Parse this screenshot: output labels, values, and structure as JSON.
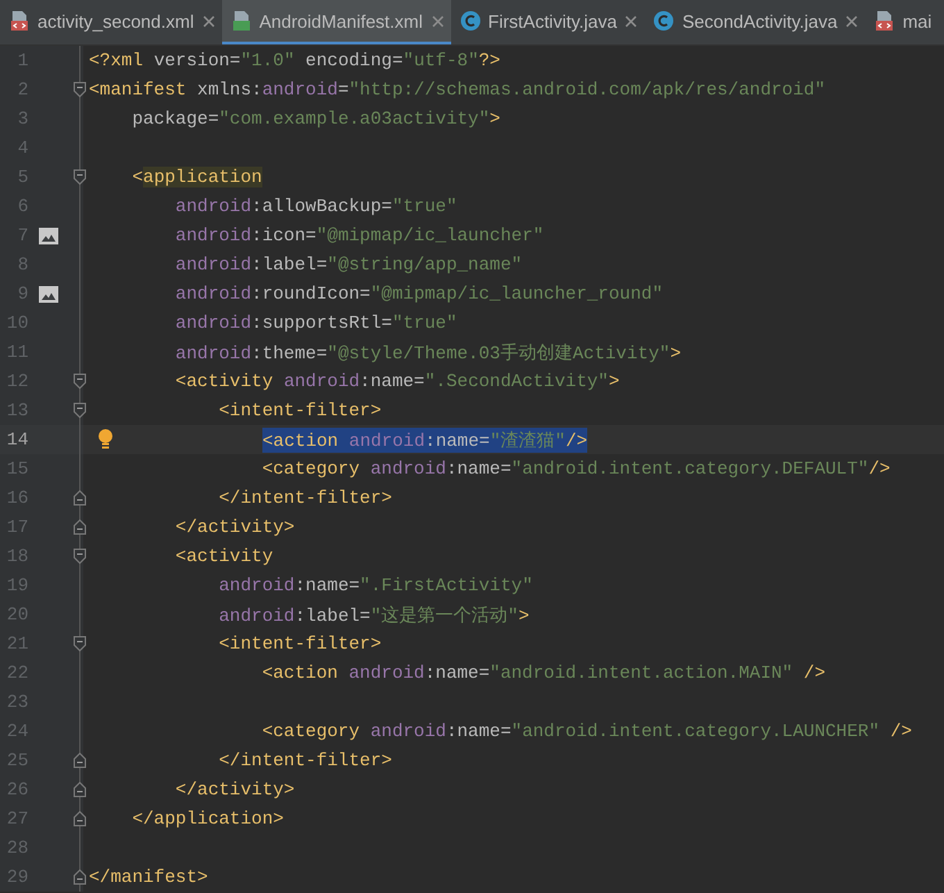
{
  "tabs": [
    {
      "label": "activity_second.xml",
      "kind": "xml",
      "selected": false,
      "closable": true
    },
    {
      "label": "AndroidManifest.xml",
      "kind": "manifest",
      "selected": true,
      "closable": true
    },
    {
      "label": "FirstActivity.java",
      "kind": "class",
      "selected": false,
      "closable": true
    },
    {
      "label": "SecondActivity.java",
      "kind": "class",
      "selected": false,
      "closable": true
    },
    {
      "label": "mai",
      "kind": "xml",
      "selected": false,
      "closable": false
    }
  ],
  "editor": {
    "lines": [
      {
        "number": "1",
        "kind": "plain",
        "fold_start": false,
        "fold_end": false,
        "current": false,
        "selected": false,
        "matched": false,
        "tokens": [
          {
            "kind": "tag",
            "text": "<?xml "
          },
          {
            "kind": "attr",
            "text": "version="
          },
          {
            "kind": "value",
            "text": "\"1.0\""
          },
          {
            "kind": "attr",
            "text": " encoding="
          },
          {
            "kind": "value",
            "text": "\"utf-8\""
          },
          {
            "kind": "tag",
            "text": "?>"
          }
        ]
      },
      {
        "number": "2",
        "kind": "plain",
        "fold_start": true,
        "fold_end": false,
        "current": false,
        "selected": false,
        "matched": false,
        "tokens": [
          {
            "kind": "tag",
            "text": "<manifest "
          },
          {
            "kind": "attr",
            "text": "xmlns:"
          },
          {
            "kind": "ns",
            "text": "android"
          },
          {
            "kind": "attr",
            "text": "="
          },
          {
            "kind": "value",
            "text": "\"http://schemas.android.com/apk/res/android\""
          }
        ]
      },
      {
        "number": "3",
        "kind": "plain",
        "fold_start": false,
        "fold_end": false,
        "current": false,
        "selected": false,
        "matched": false,
        "tokens": [
          {
            "kind": "attr",
            "text": "    package="
          },
          {
            "kind": "value",
            "text": "\"com.example.a03activity\""
          },
          {
            "kind": "tag",
            "text": ">"
          }
        ]
      },
      {
        "number": "4",
        "kind": "plain",
        "fold_start": false,
        "fold_end": false,
        "current": false
      },
      {
        "number": "5",
        "kind": "plain",
        "fold_start": true,
        "fold_end": false,
        "current": false,
        "selected": false,
        "matched": true,
        "tokens": [
          {
            "kind": "tag",
            "text": "    <"
          },
          {
            "kind": "tag",
            "text": "application"
          }
        ]
      },
      {
        "number": "6",
        "kind": "plain",
        "fold_start": false,
        "fold_end": false,
        "current": false,
        "selected": false,
        "matched": false,
        "tokens": [
          {
            "kind": "ns",
            "text": "        android"
          },
          {
            "kind": "attr",
            "text": ":allowBackup="
          },
          {
            "kind": "value",
            "text": "\"true\""
          }
        ]
      },
      {
        "number": "7",
        "kind": "image",
        "fold_start": false,
        "fold_end": false,
        "current": false,
        "selected": false,
        "matched": false,
        "tokens": [
          {
            "kind": "ns",
            "text": "        android"
          },
          {
            "kind": "attr",
            "text": ":icon="
          },
          {
            "kind": "value",
            "text": "\"@mipmap/ic_launcher\""
          }
        ]
      },
      {
        "number": "8",
        "kind": "plain",
        "fold_start": false,
        "fold_end": false,
        "current": false,
        "selected": false,
        "matched": false,
        "tokens": [
          {
            "kind": "ns",
            "text": "        android"
          },
          {
            "kind": "attr",
            "text": ":label="
          },
          {
            "kind": "value",
            "text": "\"@string/app_name\""
          }
        ]
      },
      {
        "number": "9",
        "kind": "image",
        "fold_start": false,
        "fold_end": false,
        "current": false,
        "selected": false,
        "matched": false,
        "tokens": [
          {
            "kind": "ns",
            "text": "        android"
          },
          {
            "kind": "attr",
            "text": ":roundIcon="
          },
          {
            "kind": "value",
            "text": "\"@mipmap/ic_launcher_round\""
          }
        ]
      },
      {
        "number": "10",
        "kind": "plain",
        "fold_start": false,
        "fold_end": false,
        "current": false,
        "selected": false,
        "matched": false,
        "tokens": [
          {
            "kind": "ns",
            "text": "        android"
          },
          {
            "kind": "attr",
            "text": ":supportsRtl="
          },
          {
            "kind": "value",
            "text": "\"true\""
          }
        ]
      },
      {
        "number": "11",
        "kind": "plain",
        "fold_start": false,
        "fold_end": false,
        "current": false,
        "selected": false,
        "matched": false,
        "tokens": [
          {
            "kind": "ns",
            "text": "        android"
          },
          {
            "kind": "attr",
            "text": ":theme="
          },
          {
            "kind": "value",
            "text": "\"@style/Theme.03手动创建Activity\""
          },
          {
            "kind": "tag",
            "text": ">"
          }
        ]
      },
      {
        "number": "12",
        "kind": "plain",
        "fold_start": true,
        "fold_end": false,
        "current": false,
        "selected": false,
        "matched": false,
        "tokens": [
          {
            "kind": "tag",
            "text": "        <activity "
          },
          {
            "kind": "ns",
            "text": "android"
          },
          {
            "kind": "attr",
            "text": ":name="
          },
          {
            "kind": "value",
            "text": "\".SecondActivity\""
          },
          {
            "kind": "tag",
            "text": ">"
          }
        ]
      },
      {
        "number": "13",
        "kind": "plain",
        "fold_start": true,
        "fold_end": false,
        "current": false,
        "selected": false,
        "matched": false,
        "tokens": [
          {
            "kind": "tag",
            "text": "            <intent-filter>"
          }
        ]
      },
      {
        "number": "14",
        "kind": "bulb",
        "fold_start": false,
        "fold_end": false,
        "current": true,
        "selected": true,
        "matched": false,
        "tokens": [
          {
            "kind": "tag",
            "text": "<action "
          },
          {
            "kind": "ns",
            "text": "android"
          },
          {
            "kind": "attr",
            "text": ":name="
          },
          {
            "kind": "value",
            "text": "\"渣渣猫\""
          },
          {
            "kind": "tag",
            "text": "/>"
          }
        ]
      },
      {
        "number": "15",
        "kind": "plain",
        "fold_start": false,
        "fold_end": false,
        "current": false,
        "selected": false,
        "matched": false,
        "tokens": [
          {
            "kind": "tag",
            "text": "                <category "
          },
          {
            "kind": "ns",
            "text": "android"
          },
          {
            "kind": "attr",
            "text": ":name="
          },
          {
            "kind": "value",
            "text": "\"android.intent.category.DEFAULT\""
          },
          {
            "kind": "tag",
            "text": "/>"
          }
        ]
      },
      {
        "number": "16",
        "kind": "plain",
        "fold_start": false,
        "fold_end": true,
        "current": false,
        "selected": false,
        "matched": false,
        "tokens": [
          {
            "kind": "tag",
            "text": "            </intent-filter>"
          }
        ]
      },
      {
        "number": "17",
        "kind": "plain",
        "fold_start": false,
        "fold_end": true,
        "current": false,
        "selected": false,
        "matched": false,
        "tokens": [
          {
            "kind": "tag",
            "text": "        </activity>"
          }
        ]
      },
      {
        "number": "18",
        "kind": "plain",
        "fold_start": true,
        "fold_end": false,
        "current": false,
        "selected": false,
        "matched": false,
        "tokens": [
          {
            "kind": "tag",
            "text": "        <activity"
          }
        ]
      },
      {
        "number": "19",
        "kind": "plain",
        "fold_start": false,
        "fold_end": false,
        "current": false,
        "selected": false,
        "matched": false,
        "tokens": [
          {
            "kind": "ns",
            "text": "            android"
          },
          {
            "kind": "attr",
            "text": ":name="
          },
          {
            "kind": "value",
            "text": "\".FirstActivity\""
          }
        ]
      },
      {
        "number": "20",
        "kind": "plain",
        "fold_start": false,
        "fold_end": false,
        "current": false,
        "selected": false,
        "matched": false,
        "tokens": [
          {
            "kind": "ns",
            "text": "            android"
          },
          {
            "kind": "attr",
            "text": ":label="
          },
          {
            "kind": "value",
            "text": "\"这是第一个活动\""
          },
          {
            "kind": "tag",
            "text": ">"
          }
        ]
      },
      {
        "number": "21",
        "kind": "plain",
        "fold_start": true,
        "fold_end": false,
        "current": false,
        "selected": false,
        "matched": false,
        "tokens": [
          {
            "kind": "tag",
            "text": "            <intent-filter>"
          }
        ]
      },
      {
        "number": "22",
        "kind": "plain",
        "fold_start": false,
        "fold_end": false,
        "current": false,
        "selected": false,
        "matched": false,
        "tokens": [
          {
            "kind": "tag",
            "text": "                <action "
          },
          {
            "kind": "ns",
            "text": "android"
          },
          {
            "kind": "attr",
            "text": ":name="
          },
          {
            "kind": "value",
            "text": "\"android.intent.action.MAIN\""
          },
          {
            "kind": "tag",
            "text": " />"
          }
        ]
      },
      {
        "number": "23",
        "kind": "plain",
        "fold_start": false,
        "fold_end": false,
        "current": false
      },
      {
        "number": "24",
        "kind": "plain",
        "fold_start": false,
        "fold_end": false,
        "current": false,
        "selected": false,
        "matched": false,
        "tokens": [
          {
            "kind": "tag",
            "text": "                <category "
          },
          {
            "kind": "ns",
            "text": "android"
          },
          {
            "kind": "attr",
            "text": ":name="
          },
          {
            "kind": "value",
            "text": "\"android.intent.category.LAUNCHER\""
          },
          {
            "kind": "tag",
            "text": " />"
          }
        ]
      },
      {
        "number": "25",
        "kind": "plain",
        "fold_start": false,
        "fold_end": true,
        "current": false,
        "selected": false,
        "matched": false,
        "tokens": [
          {
            "kind": "tag",
            "text": "            </intent-filter>"
          }
        ]
      },
      {
        "number": "26",
        "kind": "plain",
        "fold_start": false,
        "fold_end": true,
        "current": false,
        "selected": false,
        "matched": false,
        "tokens": [
          {
            "kind": "tag",
            "text": "        </activity>"
          }
        ]
      },
      {
        "number": "27",
        "kind": "plain",
        "fold_start": false,
        "fold_end": true,
        "current": false,
        "selected": false,
        "matched": false,
        "tokens": [
          {
            "kind": "tag",
            "text": "    </application>"
          }
        ]
      },
      {
        "number": "28",
        "kind": "plain",
        "fold_start": false,
        "fold_end": false,
        "current": false
      },
      {
        "number": "29",
        "kind": "plain",
        "fold_start": false,
        "fold_end": true,
        "current": false,
        "selected": false,
        "matched": false,
        "tokens": [
          {
            "kind": "tag",
            "text": "</manifest>"
          }
        ]
      }
    ]
  }
}
